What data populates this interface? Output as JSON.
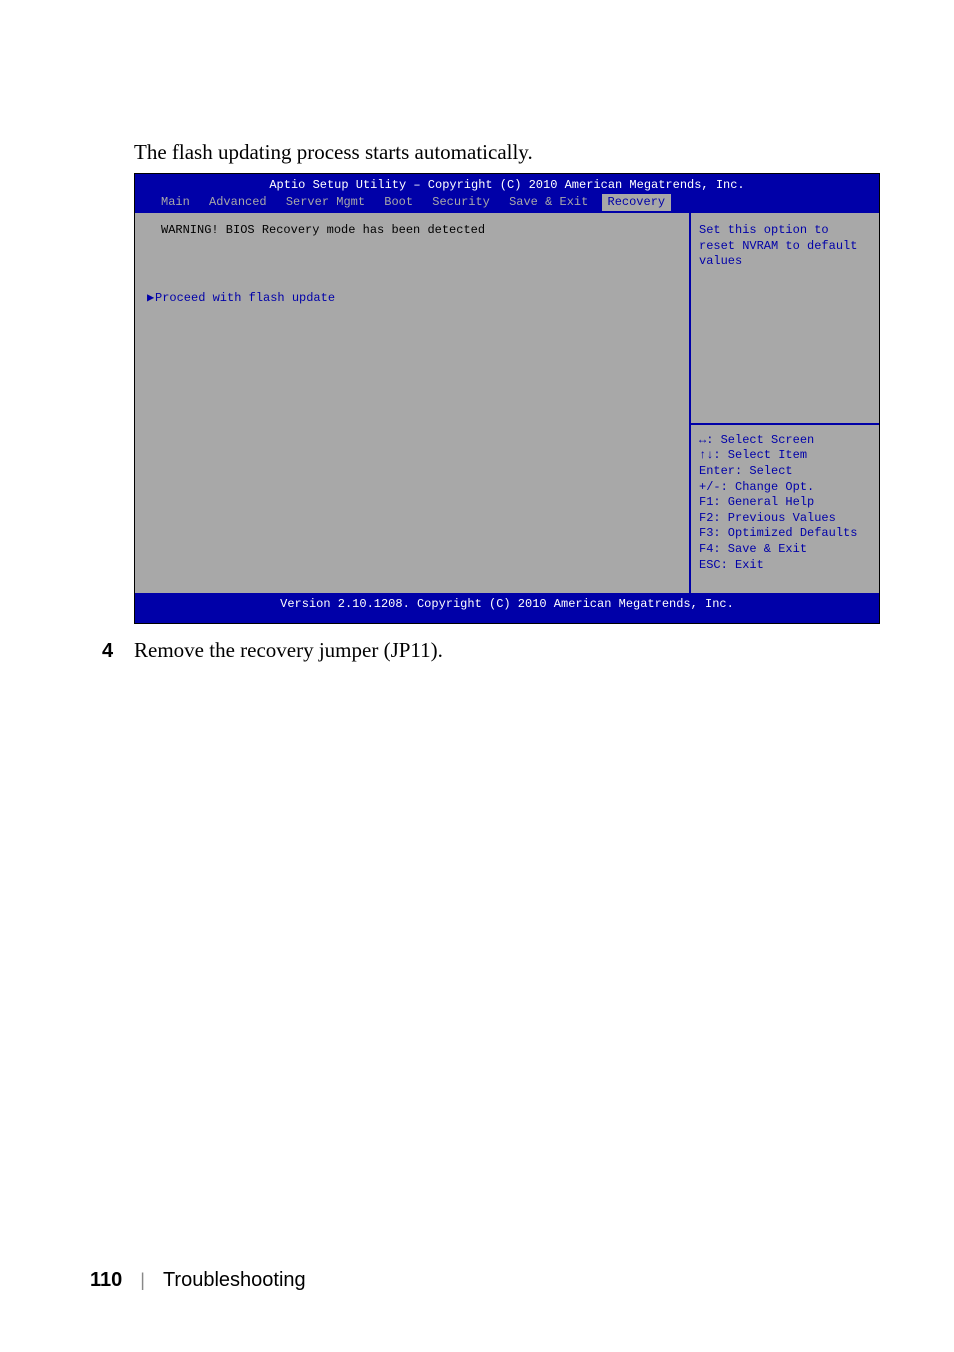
{
  "intro_text": "The flash updating process starts automatically.",
  "bios": {
    "header": "Aptio Setup Utility – Copyright (C) 2010 American Megatrends, Inc.",
    "tabs": [
      "Main",
      "Advanced",
      "Server Mgmt",
      "Boot",
      "Security",
      "Save & Exit",
      "Recovery"
    ],
    "warning": "WARNING! BIOS Recovery mode has been detected",
    "flash_line": "Proceed with flash update",
    "help_text": "Set this option to reset NVRAM to default values",
    "keys": {
      "k1": "↔: Select Screen",
      "k2": "↑↓: Select Item",
      "k3": "Enter: Select",
      "k4": "+/-: Change Opt.",
      "k5": "F1: General Help",
      "k6": "F2: Previous Values",
      "k7": "F3: Optimized Defaults",
      "k8": "F4: Save & Exit",
      "k9": "ESC: Exit"
    },
    "footer": "Version 2.10.1208. Copyright (C) 2010 American Megatrends, Inc."
  },
  "step": {
    "num": "4",
    "text": "Remove the recovery jumper (JP11)."
  },
  "footer": {
    "page_num": "110",
    "sep": "|",
    "section": "Troubleshooting"
  }
}
